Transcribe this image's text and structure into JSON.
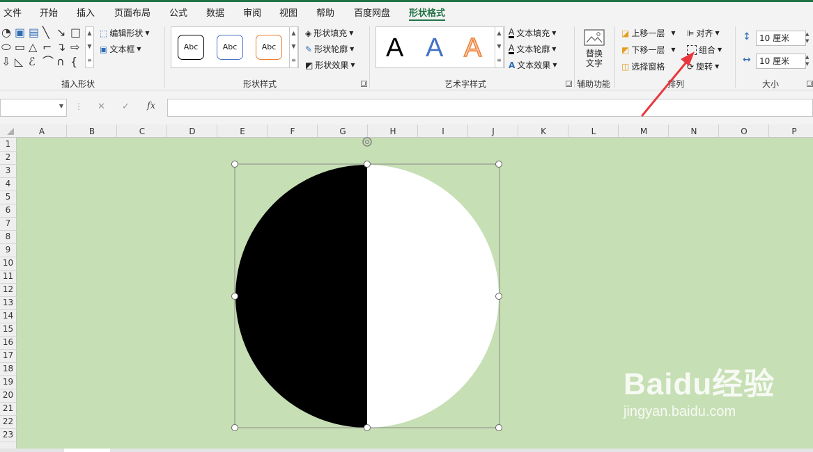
{
  "menu": {
    "items": [
      "文件",
      "开始",
      "插入",
      "页面布局",
      "公式",
      "数据",
      "审阅",
      "视图",
      "帮助",
      "百度网盘",
      "形状格式"
    ],
    "active": "形状格式"
  },
  "ribbon": {
    "insert_shapes": {
      "edit_shape_label": "编辑形状",
      "text_box_label": "文本框",
      "group_label": "插入形状"
    },
    "shape_styles": {
      "sample_label": "Abc",
      "fill_label": "形状填充",
      "outline_label": "形状轮廓",
      "effects_label": "形状效果",
      "group_label": "形状样式",
      "sample_colors": [
        "#000000",
        "#4472c4",
        "#ed7d31"
      ]
    },
    "wordart_styles": {
      "sample_letter": "A",
      "text_fill_label": "文本填充",
      "text_outline_label": "文本轮廓",
      "text_effects_label": "文本效果",
      "group_label": "艺术字样式",
      "sample_colors": [
        "#000000",
        "#4472c4",
        "#f4b183"
      ]
    },
    "accessibility": {
      "alt_text_line1": "替换",
      "alt_text_line2": "文字",
      "group_label": "辅助功能"
    },
    "arrange": {
      "bring_forward_label": "上移一层",
      "send_backward_label": "下移一层",
      "selection_pane_label": "选择窗格",
      "align_label": "对齐",
      "group_button_label": "组合",
      "rotate_label": "旋转",
      "group_label": "排列"
    },
    "size": {
      "height_value": "10 厘米",
      "width_value": "10 厘米",
      "group_label": "大小"
    }
  },
  "formula_bar": {
    "cancel_symbol": "✕",
    "enter_symbol": "✓",
    "fx_label": "fx",
    "formula_value": ""
  },
  "columns": [
    "A",
    "B",
    "C",
    "D",
    "E",
    "F",
    "G",
    "H",
    "I",
    "J",
    "K",
    "L",
    "M",
    "N",
    "O",
    "P"
  ],
  "rows": [
    "1",
    "2",
    "3",
    "4",
    "5",
    "6",
    "7",
    "8",
    "9",
    "10",
    "11",
    "12",
    "13",
    "14",
    "15",
    "16",
    "17",
    "18",
    "19",
    "20",
    "21",
    "22",
    "23"
  ],
  "shape": {
    "left_half_color": "#000000",
    "right_half_color": "#ffffff",
    "sheet_background": "#c6dfb4"
  },
  "watermark": {
    "main_text": "Baidu经验",
    "sub_text": "jingyan.baidu.com"
  },
  "annotation": {
    "arrow_color": "#e8383d"
  }
}
